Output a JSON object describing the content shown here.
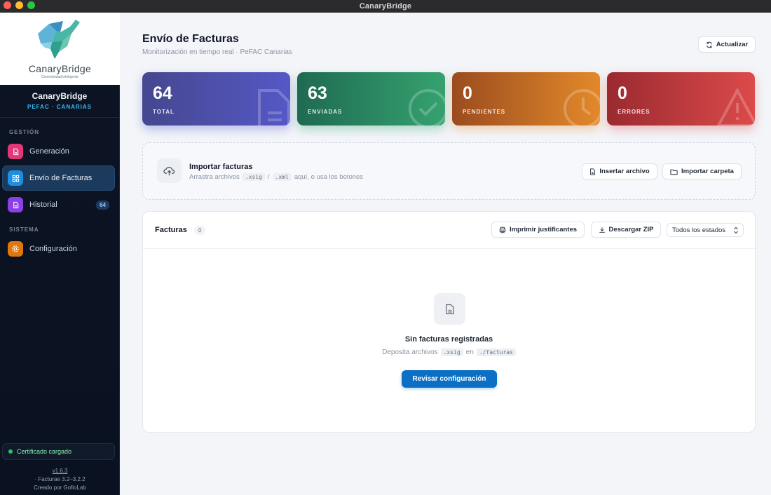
{
  "window": {
    "title": "CanaryBridge"
  },
  "sidebar": {
    "logo": {
      "name": "CanaryBridge",
      "tagline": "Conectividad inteligente"
    },
    "brand": {
      "name": "CanaryBridge",
      "subtitle": "PEFAC · CANARIAS"
    },
    "sections": [
      {
        "label": "GESTIÓN"
      },
      {
        "label": "SISTEMA"
      }
    ],
    "items": [
      {
        "label": "Generación",
        "icon": "document-icon",
        "color": "#e3377a"
      },
      {
        "label": "Envío de Facturas",
        "icon": "grid-icon",
        "color": "#1d8fe0",
        "active": true
      },
      {
        "label": "Historial",
        "icon": "document-icon",
        "color": "#8b3fe6",
        "badge": "64"
      },
      {
        "label": "Configuración",
        "icon": "gear-icon",
        "color": "#e0770e"
      }
    ],
    "certificate": {
      "label": "Certificado cargado"
    },
    "footer": {
      "version": "v1.6.3",
      "facturae": "· Facturae 3.2–3.2.2",
      "credit": "Creado por GofioLab"
    }
  },
  "header": {
    "title": "Envío de Facturas",
    "subtitle": "Monitorización en tiempo real · PeFAC Canarias",
    "refresh_label": "Actualizar"
  },
  "stats": [
    {
      "value": "64",
      "label": "TOTAL",
      "icon": "document-icon"
    },
    {
      "value": "63",
      "label": "ENVIADAS",
      "icon": "check-circle-icon"
    },
    {
      "value": "0",
      "label": "PENDIENTES",
      "icon": "clock-icon"
    },
    {
      "value": "0",
      "label": "ERRORES",
      "icon": "warning-icon"
    }
  ],
  "import": {
    "title": "Importar facturas",
    "desc_prefix": "Arrastra archivos",
    "ext1": ".xsig",
    "separator": "/",
    "ext2": ".xml",
    "desc_suffix": "aquí, o usa los botones",
    "insert_label": "Insertar archivo",
    "folder_label": "Importar carpeta"
  },
  "invoices": {
    "title": "Facturas",
    "count": "0",
    "print_label": "Imprimir justificantes",
    "zip_label": "Descargar ZIP",
    "filter_selected": "Todos los estados",
    "empty": {
      "title": "Sin facturas registradas",
      "desc_prefix": "Deposita archivos",
      "ext": ".xsig",
      "desc_middle": "en",
      "path": "./facturas",
      "button_label": "Revisar configuración"
    }
  },
  "colors": {
    "accent": "#0b6fc4",
    "total": "#5558c6",
    "sent": "#35a26f",
    "pending": "#e3892a",
    "errors": "#dc4a4a"
  }
}
